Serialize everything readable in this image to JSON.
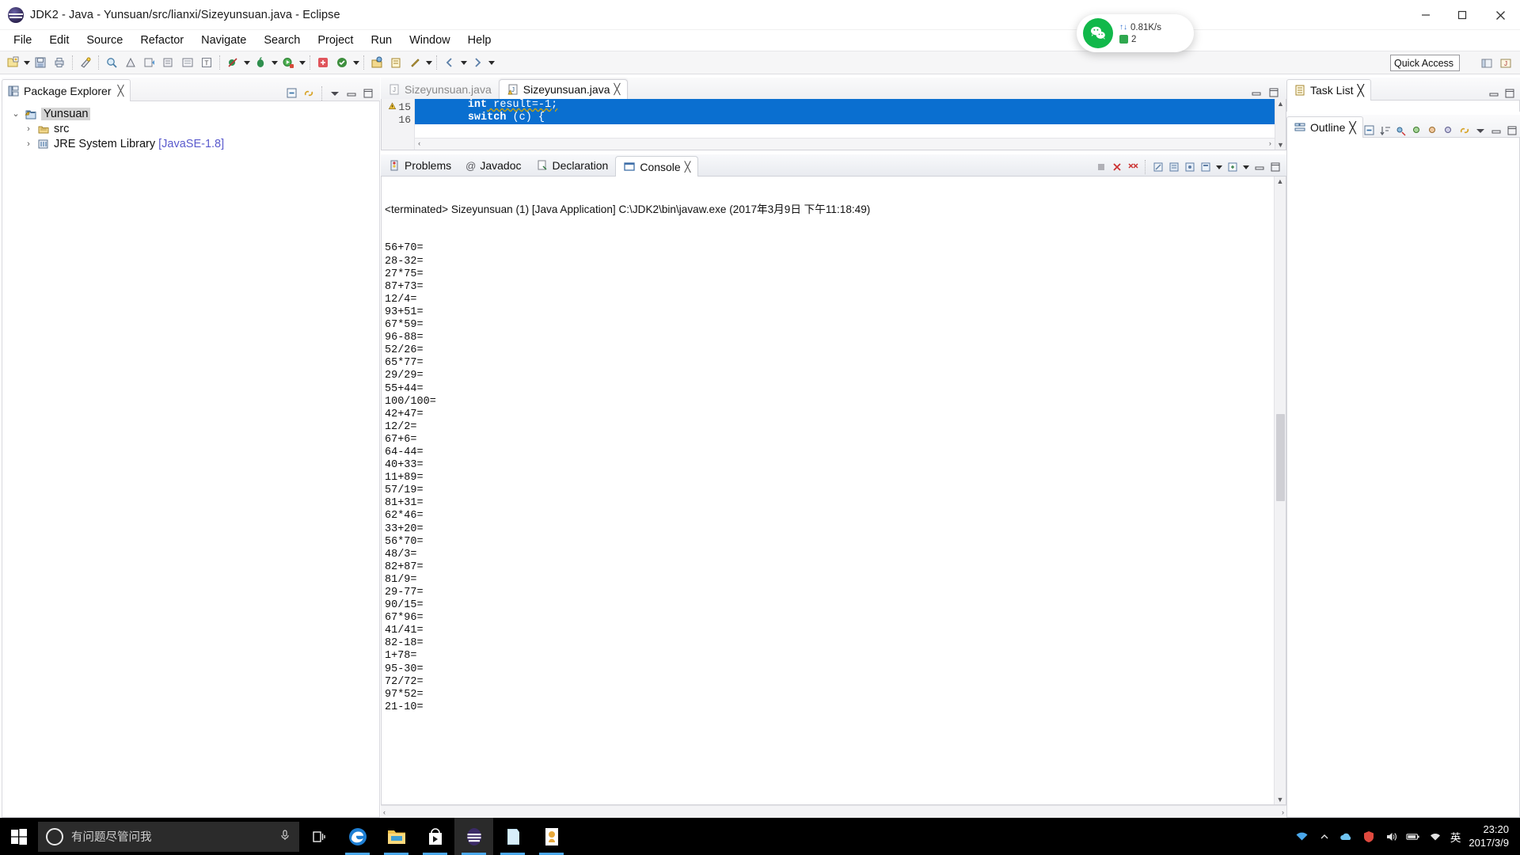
{
  "window": {
    "title": "JDK2 - Java - Yunsuan/src/lianxi/Sizeyunsuan.java - Eclipse",
    "app_icon": "eclipse-icon",
    "minimize_label": "–",
    "maximize_label": "❐",
    "close_label": "✕"
  },
  "menubar": {
    "items": [
      {
        "label": "File"
      },
      {
        "label": "Edit"
      },
      {
        "label": "Source"
      },
      {
        "label": "Refactor"
      },
      {
        "label": "Navigate"
      },
      {
        "label": "Search"
      },
      {
        "label": "Project"
      },
      {
        "label": "Run"
      },
      {
        "label": "Window"
      },
      {
        "label": "Help"
      }
    ]
  },
  "toolbar": {
    "quick_access_placeholder": "Quick Access",
    "quick_access_value": "Quick Access",
    "buttons": [
      {
        "name": "new-wizard-icon"
      },
      {
        "name": "save-icon"
      },
      {
        "name": "print-icon"
      },
      {
        "name": "quick-fix-icon"
      },
      {
        "name": "search-icon"
      },
      {
        "name": "toggle-mark-occurrences-icon"
      },
      {
        "name": "next-annotation-icon"
      },
      {
        "name": "previous-annotation-icon"
      },
      {
        "name": "last-edit-location-icon"
      },
      {
        "name": "skip-breakpoints-icon"
      },
      {
        "name": "debug-icon"
      },
      {
        "name": "run-icon"
      },
      {
        "name": "run-external-tools-icon"
      },
      {
        "name": "new-java-project-icon"
      },
      {
        "name": "new-java-package-icon"
      },
      {
        "name": "open-type-icon"
      },
      {
        "name": "open-task-icon"
      },
      {
        "name": "pin-icon"
      },
      {
        "name": "back-icon"
      },
      {
        "name": "forward-icon"
      }
    ],
    "perspective": [
      {
        "name": "open-perspective-icon"
      },
      {
        "name": "java-perspective-icon"
      }
    ]
  },
  "package_explorer": {
    "tab_label": "Package Explorer",
    "tab_close": "╳",
    "tools": [
      {
        "name": "collapse-all-icon"
      },
      {
        "name": "link-with-editor-icon"
      },
      {
        "name": "view-menu-icon"
      },
      {
        "name": "minimize-view-icon"
      },
      {
        "name": "maximize-view-icon"
      }
    ],
    "tree": [
      {
        "label": "Yunsuan",
        "icon": "java-project-icon",
        "twisty": "⌄",
        "level": 1,
        "selected": true,
        "sub": ""
      },
      {
        "label": "src",
        "icon": "source-folder-icon",
        "twisty": "›",
        "level": 2,
        "selected": false,
        "sub": ""
      },
      {
        "label": "JRE System Library",
        "icon": "jre-library-icon",
        "twisty": "›",
        "level": 2,
        "selected": false,
        "sub": "[JavaSE-1.8]"
      }
    ]
  },
  "editor": {
    "tabs": [
      {
        "label": "Sizeyunsuan.java",
        "active": false,
        "icon": "java-file-icon",
        "close": ""
      },
      {
        "label": "Sizeyunsuan.java",
        "active": true,
        "icon": "java-file-warning-icon",
        "close": "╳"
      }
    ],
    "tools": [
      {
        "name": "minimize-editor-icon"
      },
      {
        "name": "maximize-editor-icon"
      }
    ],
    "lines": [
      {
        "number": "15",
        "marker": "warning-marker-icon",
        "indent": "        ",
        "kw": "int",
        "rest": " result=-1;",
        "selected": true
      },
      {
        "number": "16",
        "marker": "",
        "indent": "        ",
        "kw": "switch",
        "rest": " (c) {",
        "selected": true
      }
    ],
    "hscroll_left": "‹",
    "hscroll_right": "›",
    "vscroll_up": "▲",
    "vscroll_down": "▼"
  },
  "console": {
    "tabs": [
      {
        "label": "Problems",
        "icon": "problems-icon",
        "active": false,
        "close": ""
      },
      {
        "label": "Javadoc",
        "icon": "javadoc-icon",
        "active": false,
        "close": ""
      },
      {
        "label": "Declaration",
        "icon": "declaration-icon",
        "active": false,
        "close": ""
      },
      {
        "label": "Console",
        "icon": "console-icon",
        "active": true,
        "close": "╳"
      }
    ],
    "tools": [
      {
        "name": "terminate-icon"
      },
      {
        "name": "remove-launch-icon"
      },
      {
        "name": "remove-all-terminated-icon"
      },
      {
        "name": "clear-console-icon"
      },
      {
        "name": "scroll-lock-icon"
      },
      {
        "name": "pin-console-icon"
      },
      {
        "name": "display-selected-console-icon"
      },
      {
        "name": "open-console-icon"
      },
      {
        "name": "console-view-menu-icon"
      },
      {
        "name": "minimize-console-icon"
      },
      {
        "name": "maximize-console-icon"
      }
    ],
    "terminated_line": "<terminated> Sizeyunsuan (1) [Java Application] C:\\JDK2\\bin\\javaw.exe (2017年3月9日 下午11:18:49)",
    "output_lines": [
      "56+70=",
      "28-32=",
      "27*75=",
      "87+73=",
      "12/4=",
      "93+51=",
      "67*59=",
      "96-88=",
      "52/26=",
      "65*77=",
      "29/29=",
      "55+44=",
      "100/100=",
      "42+47=",
      "12/2=",
      "67+6=",
      "64-44=",
      "40+33=",
      "11+89=",
      "57/19=",
      "81+31=",
      "62*46=",
      "33+20=",
      "56*70=",
      "48/3=",
      "82+87=",
      "81/9=",
      "29-77=",
      "90/15=",
      "67*96=",
      "41/41=",
      "82-18=",
      "1+78=",
      "95-30=",
      "72/72=",
      "97*52=",
      "21-10="
    ],
    "hscroll_left": "‹",
    "hscroll_right": "›",
    "vscroll_up": "▲",
    "vscroll_down": "▼"
  },
  "task_list": {
    "tab_label": "Task List",
    "tab_close": "╳",
    "tools": [
      {
        "name": "new-task-icon"
      },
      {
        "name": "categorize-icon"
      },
      {
        "name": "focus-on-workweek-icon"
      },
      {
        "name": "synchronize-icon"
      },
      {
        "name": "task-view-menu-icon"
      },
      {
        "name": "minimize-task-icon"
      },
      {
        "name": "maximize-task-icon"
      }
    ]
  },
  "outline": {
    "tab_label": "Outline",
    "tab_close": "╳",
    "tools": [
      {
        "name": "collapse-all-icon"
      },
      {
        "name": "sort-icon"
      },
      {
        "name": "hide-fields-icon"
      },
      {
        "name": "hide-static-icon"
      },
      {
        "name": "hide-nonpublic-icon"
      },
      {
        "name": "hide-local-types-icon"
      },
      {
        "name": "link-with-editor-icon"
      },
      {
        "name": "outline-view-menu-icon"
      },
      {
        "name": "minimize-outline-icon"
      },
      {
        "name": "maximize-outline-icon"
      }
    ]
  },
  "network_popup": {
    "logo": "wechat-icon",
    "speed": "0.81K/s",
    "count": "2",
    "speed_arrows": "↑↓"
  },
  "taskbar": {
    "start_icon": "windows-start-icon",
    "cortana_placeholder": "有问题尽管问我",
    "mic_icon": "microphone-icon",
    "apps": [
      {
        "name": "task-view-icon",
        "running": false,
        "active": false
      },
      {
        "name": "edge-browser-icon",
        "running": true,
        "active": false
      },
      {
        "name": "file-explorer-icon",
        "running": true,
        "active": false
      },
      {
        "name": "microsoft-store-icon",
        "running": true,
        "active": false
      },
      {
        "name": "eclipse-icon",
        "running": true,
        "active": true
      },
      {
        "name": "notepad-icon",
        "running": true,
        "active": false
      },
      {
        "name": "media-player-icon",
        "running": true,
        "active": false
      }
    ],
    "tray": [
      {
        "name": "network-icon"
      },
      {
        "name": "show-hidden-icons-icon"
      },
      {
        "name": "onedrive-icon"
      },
      {
        "name": "antivirus-icon"
      },
      {
        "name": "volume-icon"
      },
      {
        "name": "battery-icon"
      },
      {
        "name": "wifi-icon"
      }
    ],
    "ime_label": "英",
    "time": "23:20",
    "date": "2017/3/9"
  },
  "colors": {
    "selection_blue": "#0a6fd0",
    "keyword_purple": "#7d0055",
    "library_blue": "#5a5acd",
    "taskbar_black": "#000000",
    "accent_green": "#11b84a"
  }
}
